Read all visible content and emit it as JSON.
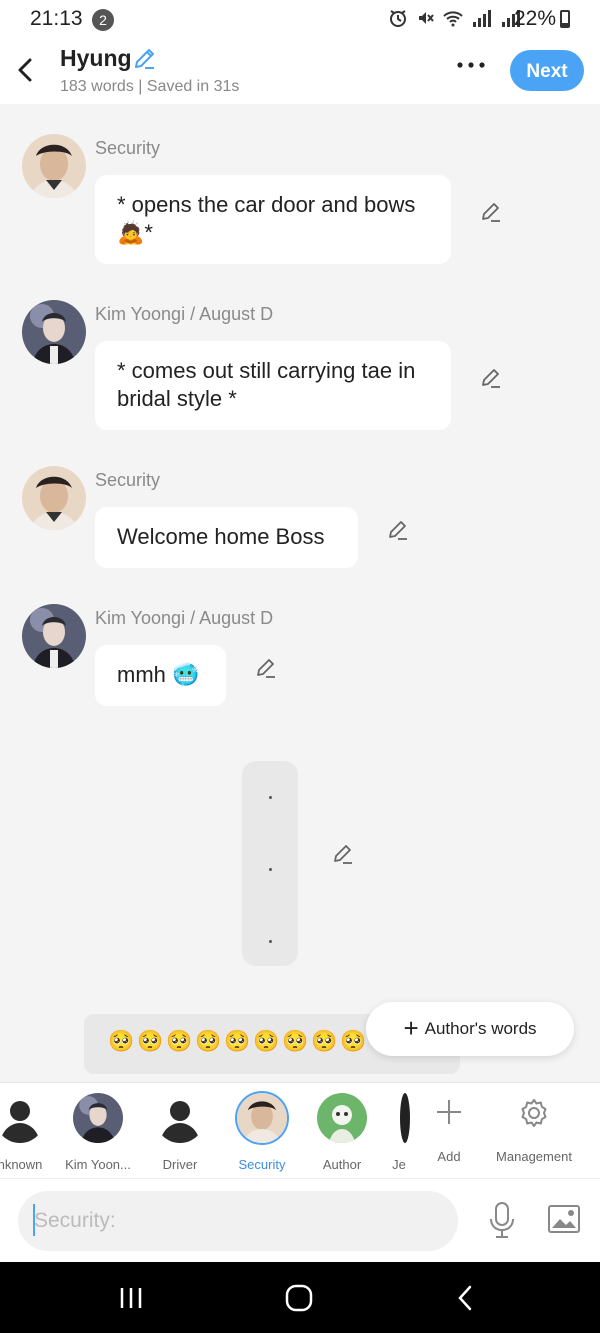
{
  "status_bar": {
    "time": "21:13",
    "notification_count": "2",
    "battery": "22%"
  },
  "header": {
    "title": "Hyung",
    "subtitle": "183 words | Saved in 31s",
    "next_label": "Next"
  },
  "messages": [
    {
      "sender": "Security",
      "text": "* opens the car door and bows 🙇*"
    },
    {
      "sender": "Kim Yoongi / August  D",
      "text": "* comes out still carrying tae in bridal style *"
    },
    {
      "sender": "Security",
      "text": "Welcome home Boss"
    },
    {
      "sender": "Kim Yoongi / August  D",
      "text": "mmh 🥶"
    }
  ],
  "pending_dots": [
    ".",
    ".",
    "."
  ],
  "emoji_bar": {
    "emojis": [
      "🥺",
      "🥺",
      "🥺",
      "🥺",
      "🥺",
      "🥺",
      "🥺",
      "🥺",
      "🥺"
    ]
  },
  "authors_words": {
    "label": "Author's words"
  },
  "characters": [
    {
      "name": "nknown",
      "selected": false
    },
    {
      "name": "Kim Yoon...",
      "selected": false
    },
    {
      "name": "Driver",
      "selected": false
    },
    {
      "name": "Security",
      "selected": true
    },
    {
      "name": "Author",
      "selected": false
    },
    {
      "name": "Je",
      "selected": false
    },
    {
      "name": "Add",
      "selected": false
    },
    {
      "name": "Management",
      "selected": false
    }
  ],
  "input": {
    "placeholder": "Security:"
  },
  "colors": {
    "accent": "#4aa3f5",
    "selected_text": "#3a8ee6"
  }
}
